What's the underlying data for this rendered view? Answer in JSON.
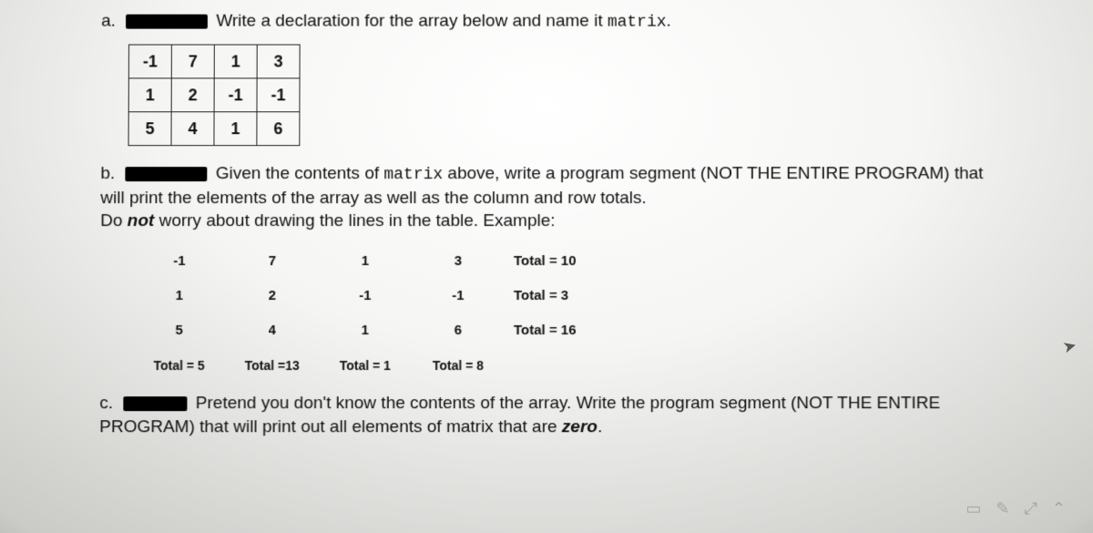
{
  "part_a": {
    "label": "a.",
    "text": "Write a declaration for the array below and name it ",
    "code_name": "matrix",
    "period": "."
  },
  "matrix": {
    "rows": [
      [
        "-1",
        "7",
        "1",
        "3"
      ],
      [
        "1",
        "2",
        "-1",
        "-1"
      ],
      [
        "5",
        "4",
        "1",
        "6"
      ]
    ]
  },
  "part_b": {
    "label": "b.",
    "line1_pre": "Given the contents of ",
    "line1_code": "matrix",
    "line1_post": " above, write a program segment (NOT THE ENTIRE PROGRAM) that",
    "line2": "will print the elements of the array as well as the column and row totals.",
    "line3_pre": "Do ",
    "line3_emph": "not",
    "line3_post": " worry about drawing the lines in the table. Example:"
  },
  "example": {
    "rows": [
      {
        "cells": [
          "-1",
          "7",
          "1",
          "3"
        ],
        "total": "Total = 10"
      },
      {
        "cells": [
          "1",
          "2",
          "-1",
          "-1"
        ],
        "total": "Total = 3"
      },
      {
        "cells": [
          "5",
          "4",
          "1",
          "6"
        ],
        "total": "Total = 16"
      }
    ],
    "col_totals": [
      "Total = 5",
      "Total =13",
      "Total = 1",
      "Total = 8"
    ]
  },
  "part_c": {
    "label": "c.",
    "line1": "Pretend you don't know the contents of the array. Write the program segment (NOT THE ENTIRE",
    "line2_pre": "PROGRAM) that will print out all elements of matrix that are ",
    "line2_emph": "zero",
    "line2_post": "."
  }
}
